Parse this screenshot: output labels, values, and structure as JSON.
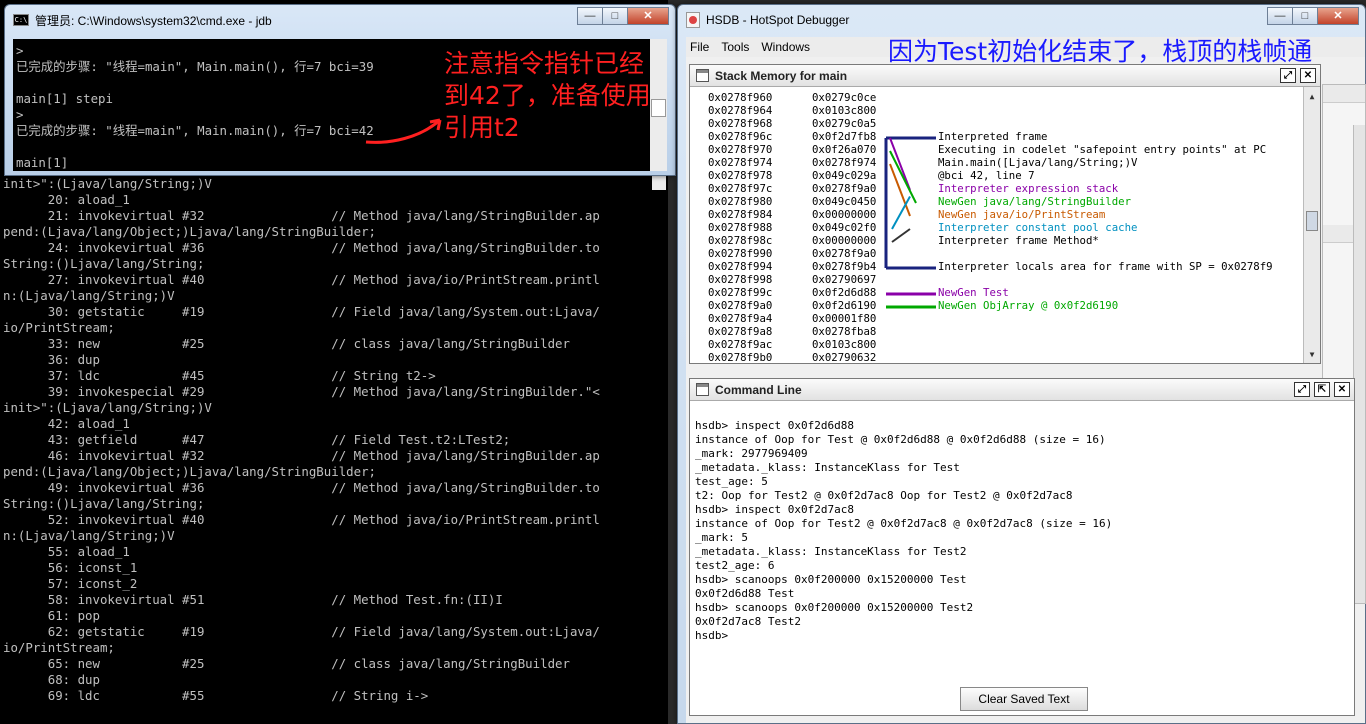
{
  "jdb_window": {
    "title": "管理员: C:\\Windows\\system32\\cmd.exe - jdb",
    "icon_text": "C:\\",
    "lines": [
      ">",
      "已完成的步骤: \"线程=main\", Main.main(), 行=7 bci=39",
      "",
      "main[1] stepi",
      ">",
      "已完成的步骤: \"线程=main\", Main.main(), 行=7 bci=42",
      "",
      "main[1]"
    ],
    "buttons": {
      "minimize": "—",
      "maximize": "□",
      "close": "✕"
    }
  },
  "red_annotation": "注意指令指针已经到42了，准备使用引用t2",
  "console_lines": [
    "init>\":(Ljava/lang/String;)V",
    "      20: aload_1",
    "      21: invokevirtual #32                 // Method java/lang/StringBuilder.ap",
    "pend:(Ljava/lang/Object;)Ljava/lang/StringBuilder;",
    "      24: invokevirtual #36                 // Method java/lang/StringBuilder.to",
    "String:()Ljava/lang/String;",
    "      27: invokevirtual #40                 // Method java/io/PrintStream.printl",
    "n:(Ljava/lang/String;)V",
    "      30: getstatic     #19                 // Field java/lang/System.out:Ljava/",
    "io/PrintStream;",
    "      33: new           #25                 // class java/lang/StringBuilder",
    "      36: dup",
    "      37: ldc           #45                 // String t2->",
    "      39: invokespecial #29                 // Method java/lang/StringBuilder.\"<",
    "init>\":(Ljava/lang/String;)V",
    "      42: aload_1",
    "      43: getfield      #47                 // Field Test.t2:LTest2;",
    "      46: invokevirtual #32                 // Method java/lang/StringBuilder.ap",
    "pend:(Ljava/lang/Object;)Ljava/lang/StringBuilder;",
    "      49: invokevirtual #36                 // Method java/lang/StringBuilder.to",
    "String:()Ljava/lang/String;",
    "      52: invokevirtual #40                 // Method java/io/PrintStream.printl",
    "n:(Ljava/lang/String;)V",
    "      55: aload_1",
    "      56: iconst_1",
    "      57: iconst_2",
    "      58: invokevirtual #51                 // Method Test.fn:(II)I",
    "      61: pop",
    "      62: getstatic     #19                 // Field java/lang/System.out:Ljava/",
    "io/PrintStream;",
    "      65: new           #25                 // class java/lang/StringBuilder",
    "      68: dup",
    "      69: ldc           #55                 // String i->"
  ],
  "hsdb_window": {
    "title": "HSDB - HotSpot Debugger",
    "menu": [
      "File",
      "Tools",
      "Windows"
    ],
    "buttons": {
      "minimize": "—",
      "maximize": "□",
      "close": "✕"
    }
  },
  "blue_annotation": "因为Test初始化结束了，栈顶的栈帧通通弹出了",
  "stack_memory": {
    "title": "Stack Memory for main",
    "addresses": [
      "0x0278f960",
      "0x0278f964",
      "0x0278f968",
      "0x0278f96c",
      "0x0278f970",
      "0x0278f974",
      "0x0278f978",
      "0x0278f97c",
      "0x0278f980",
      "0x0278f984",
      "0x0278f988",
      "0x0278f98c",
      "0x0278f990",
      "0x0278f994",
      "0x0278f998",
      "0x0278f99c",
      "0x0278f9a0",
      "0x0278f9a4",
      "0x0278f9a8",
      "0x0278f9ac",
      "0x0278f9b0"
    ],
    "values": [
      "0x0279c0ce",
      "0x0103c800",
      "0x0279c0a5",
      "0x0f2d7fb8",
      "0x0f26a070",
      "0x0278f974",
      "0x049c029a",
      "0x0278f9a0",
      "0x049c0450",
      "0x00000000",
      "0x049c02f0",
      "0x00000000",
      "0x0278f9a0",
      "0x0278f9b4",
      "0x02790697",
      "0x0f2d6d88",
      "0x0f2d6190",
      "0x00001f80",
      "0x0278fba8",
      "0x0103c800",
      "0x02790632"
    ],
    "descriptions": [
      {
        "text": "Interpreted frame",
        "color": "#000000"
      },
      {
        "text": "Executing in codelet \"safepoint entry points\" at PC",
        "color": "#000000"
      },
      {
        "text": "Main.main([Ljava/lang/String;)V",
        "color": "#000000"
      },
      {
        "text": "@bci 42, line 7",
        "color": "#000000"
      },
      {
        "text": "Interpreter expression stack",
        "color": "#8a00a8"
      },
      {
        "text": "NewGen java/lang/StringBuilder",
        "color": "#00a800"
      },
      {
        "text": "NewGen java/io/PrintStream",
        "color": "#c85a00"
      },
      {
        "text": "Interpreter constant pool cache",
        "color": "#0090c0"
      },
      {
        "text": "Interpreter frame Method*",
        "color": "#000000"
      },
      {
        "text": "Interpreter locals area for frame with SP = 0x0278f9",
        "color": "#000000"
      },
      {
        "text": "NewGen Test",
        "color": "#8a00a8"
      },
      {
        "text": "NewGen ObjArray @ 0x0f2d6190",
        "color": "#00a800"
      }
    ]
  },
  "command_line": {
    "title": "Command Line",
    "lines": [
      "hsdb> inspect 0x0f2d6d88",
      "instance of Oop for Test @ 0x0f2d6d88 @ 0x0f2d6d88 (size = 16)",
      "_mark: 2977969409",
      "_metadata._klass: InstanceKlass for Test",
      "test_age: 5",
      "t2: Oop for Test2 @ 0x0f2d7ac8 Oop for Test2 @ 0x0f2d7ac8",
      "hsdb> inspect 0x0f2d7ac8",
      "instance of Oop for Test2 @ 0x0f2d7ac8 @ 0x0f2d7ac8 (size = 16)",
      "_mark: 5",
      "_metadata._klass: InstanceKlass for Test2",
      "test2_age: 6",
      "hsdb> scanoops 0x0f200000 0x15200000 Test",
      "0x0f2d6d88 Test",
      "hsdb> scanoops 0x0f200000 0x15200000 Test2",
      "0x0f2d7ac8 Test2",
      "hsdb>"
    ],
    "clear_button": "Clear Saved Text"
  }
}
